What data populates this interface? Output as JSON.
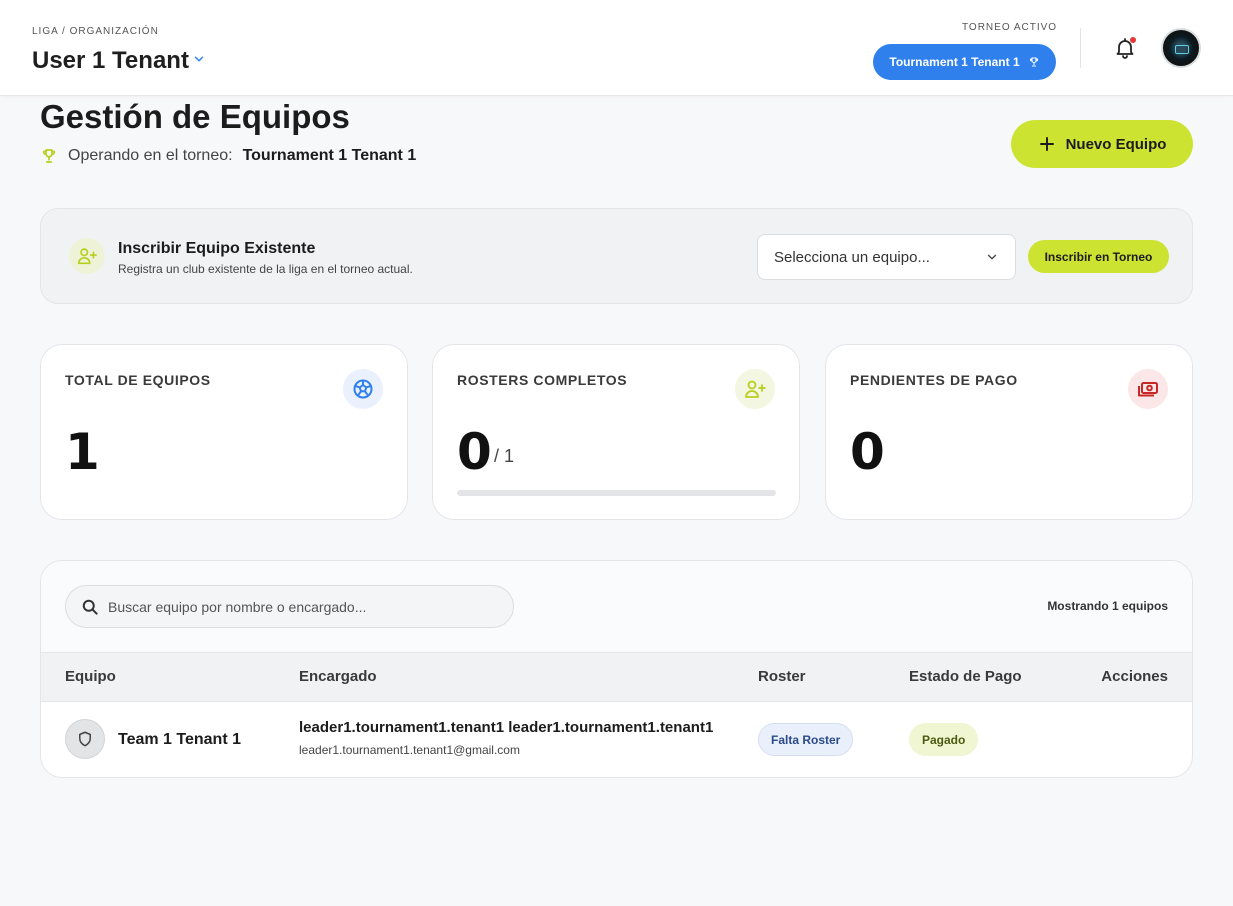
{
  "header": {
    "org_label": "LIGA / ORGANIZACIÓN",
    "org_name": "User 1 Tenant",
    "torneo_label": "TORNEO ACTIVO",
    "torneo_name": "Tournament 1 Tenant 1"
  },
  "page": {
    "title": "Gestión de Equipos",
    "subtitle_prefix": "Operando en el torneo:",
    "subtitle_tournament": "Tournament 1 Tenant 1",
    "new_button": "Nuevo Equipo"
  },
  "enroll": {
    "title": "Inscribir Equipo Existente",
    "description": "Registra un club existente de la liga en el torneo actual.",
    "select_value": "Selecciona un equipo...",
    "button": "Inscribir en Torneo"
  },
  "stats": [
    {
      "label": "TOTAL DE EQUIPOS",
      "value": "1",
      "icon": "soccer-ball-icon",
      "color": "#2f80ed"
    },
    {
      "label": "ROSTERS COMPLETOS",
      "value": "0",
      "sub": "/ 1",
      "progress": 0,
      "icon": "user-plus-icon",
      "color": "#cde332"
    },
    {
      "label": "PENDIENTES DE PAGO",
      "value": "0",
      "icon": "money-icon",
      "color": "#c62828"
    }
  ],
  "table": {
    "search_placeholder": "Buscar equipo por nombre o encargado...",
    "showing": "Mostrando 1 equipos",
    "columns": [
      "Equipo",
      "Encargado",
      "Roster",
      "Estado de Pago",
      "Acciones"
    ],
    "rows": [
      {
        "team": "Team 1 Tenant 1",
        "leader": "leader1.tournament1.tenant1 leader1.tournament1.tenant1",
        "email": "leader1.tournament1.tenant1@gmail.com",
        "roster": "Falta Roster",
        "payment": "Pagado"
      }
    ]
  },
  "colors": {
    "accent": "#cde332",
    "primary": "#2f80ed",
    "danger": "#c62828"
  }
}
